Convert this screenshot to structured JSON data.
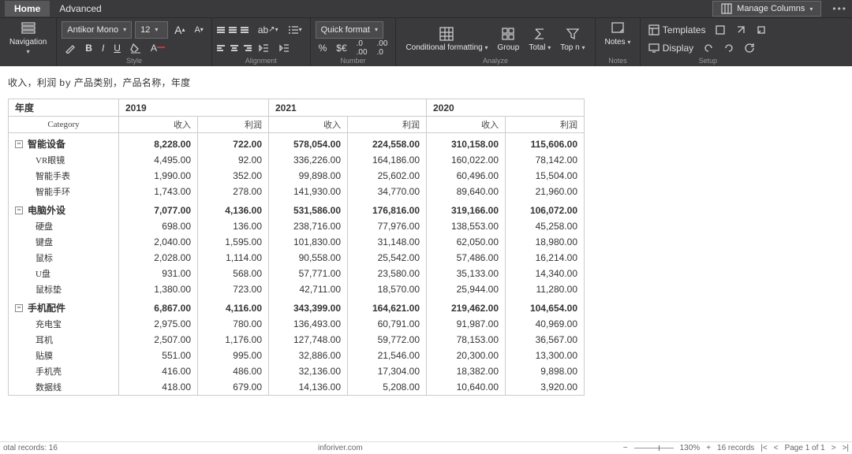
{
  "tabs": {
    "home": "Home",
    "advanced": "Advanced"
  },
  "manage_cols": "Manage Columns",
  "font": {
    "name": "Antikor Mono",
    "size": "12"
  },
  "quick_format": "Quick format",
  "analyze": {
    "cond": "Conditional formatting",
    "group": "Group",
    "total": "Total",
    "topn": "Top n"
  },
  "notes": "Notes",
  "setup": {
    "templates": "Templates",
    "display": "Display"
  },
  "grp_labels": {
    "style": "Style",
    "alignment": "Alignment",
    "number": "Number",
    "analyze": "Analyze",
    "notes": "Notes",
    "setup": "Setup"
  },
  "title": {
    "a": "收入，利润",
    "by": "by",
    "b": "产品类别，产品名称，年度"
  },
  "cols": {
    "year": "年度",
    "category": "Category",
    "rev": "收入",
    "prof": "利润",
    "y2019": "2019",
    "y2021": "2021",
    "y2020": "2020"
  },
  "data": [
    {
      "name": "智能设备",
      "sum": {
        "r19": "8,228.00",
        "p19": "722.00",
        "r21": "578,054.00",
        "p21": "224,558.00",
        "r20": "310,158.00",
        "p20": "115,606.00"
      },
      "rows": [
        {
          "n": "VR眼镜",
          "r19": "4,495.00",
          "p19": "92.00",
          "r21": "336,226.00",
          "p21": "164,186.00",
          "r20": "160,022.00",
          "p20": "78,142.00"
        },
        {
          "n": "智能手表",
          "r19": "1,990.00",
          "p19": "352.00",
          "r21": "99,898.00",
          "p21": "25,602.00",
          "r20": "60,496.00",
          "p20": "15,504.00"
        },
        {
          "n": "智能手环",
          "r19": "1,743.00",
          "p19": "278.00",
          "r21": "141,930.00",
          "p21": "34,770.00",
          "r20": "89,640.00",
          "p20": "21,960.00"
        }
      ]
    },
    {
      "name": "电脑外设",
      "sum": {
        "r19": "7,077.00",
        "p19": "4,136.00",
        "r21": "531,586.00",
        "p21": "176,816.00",
        "r20": "319,166.00",
        "p20": "106,072.00"
      },
      "rows": [
        {
          "n": "硬盘",
          "r19": "698.00",
          "p19": "136.00",
          "r21": "238,716.00",
          "p21": "77,976.00",
          "r20": "138,553.00",
          "p20": "45,258.00"
        },
        {
          "n": "键盘",
          "r19": "2,040.00",
          "p19": "1,595.00",
          "r21": "101,830.00",
          "p21": "31,148.00",
          "r20": "62,050.00",
          "p20": "18,980.00"
        },
        {
          "n": "鼠标",
          "r19": "2,028.00",
          "p19": "1,114.00",
          "r21": "90,558.00",
          "p21": "25,542.00",
          "r20": "57,486.00",
          "p20": "16,214.00"
        },
        {
          "n": "U盘",
          "r19": "931.00",
          "p19": "568.00",
          "r21": "57,771.00",
          "p21": "23,580.00",
          "r20": "35,133.00",
          "p20": "14,340.00"
        },
        {
          "n": "鼠标垫",
          "r19": "1,380.00",
          "p19": "723.00",
          "r21": "42,711.00",
          "p21": "18,570.00",
          "r20": "25,944.00",
          "p20": "11,280.00"
        }
      ]
    },
    {
      "name": "手机配件",
      "sum": {
        "r19": "6,867.00",
        "p19": "4,116.00",
        "r21": "343,399.00",
        "p21": "164,621.00",
        "r20": "219,462.00",
        "p20": "104,654.00"
      },
      "rows": [
        {
          "n": "充电宝",
          "r19": "2,975.00",
          "p19": "780.00",
          "r21": "136,493.00",
          "p21": "60,791.00",
          "r20": "91,987.00",
          "p20": "40,969.00"
        },
        {
          "n": "耳机",
          "r19": "2,507.00",
          "p19": "1,176.00",
          "r21": "127,748.00",
          "p21": "59,772.00",
          "r20": "78,153.00",
          "p20": "36,567.00"
        },
        {
          "n": "贴膜",
          "r19": "551.00",
          "p19": "995.00",
          "r21": "32,886.00",
          "p21": "21,546.00",
          "r20": "20,300.00",
          "p20": "13,300.00"
        },
        {
          "n": "手机壳",
          "r19": "416.00",
          "p19": "486.00",
          "r21": "32,136.00",
          "p21": "17,304.00",
          "r20": "18,382.00",
          "p20": "9,898.00"
        },
        {
          "n": "数据线",
          "r19": "418.00",
          "p19": "679.00",
          "r21": "14,136.00",
          "p21": "5,208.00",
          "r20": "10,640.00",
          "p20": "3,920.00"
        }
      ]
    }
  ],
  "status": {
    "total": "otal records: 16",
    "brand": "inforiver.com",
    "zoom": "130%",
    "records": "16 records",
    "page": "Page 1 of 1"
  }
}
